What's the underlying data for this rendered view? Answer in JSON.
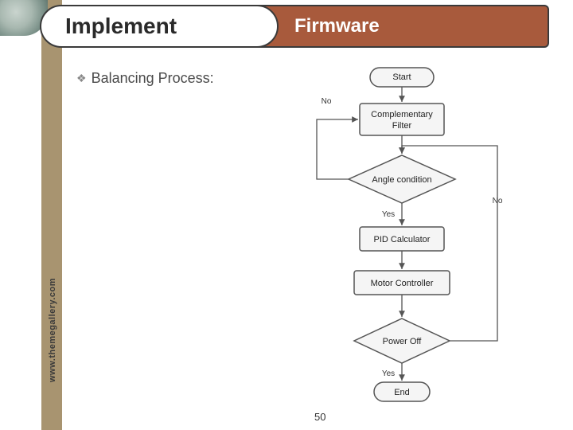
{
  "header": {
    "left": "Implement",
    "right": "Firmware"
  },
  "bullet": {
    "text": "Balancing Process:"
  },
  "watermark": "www.themegallery.com",
  "page_number": "50",
  "flowchart": {
    "nodes": {
      "start": "Start",
      "filter": "Complementary\nFilter",
      "angle": "Angle condition",
      "pid": "PID Calculator",
      "motor": "Motor Controller",
      "poweroff": "Power Off",
      "end": "End"
    },
    "edges": {
      "no_left": "No",
      "yes1": "Yes",
      "no_right": "No",
      "yes2": "Yes"
    }
  }
}
